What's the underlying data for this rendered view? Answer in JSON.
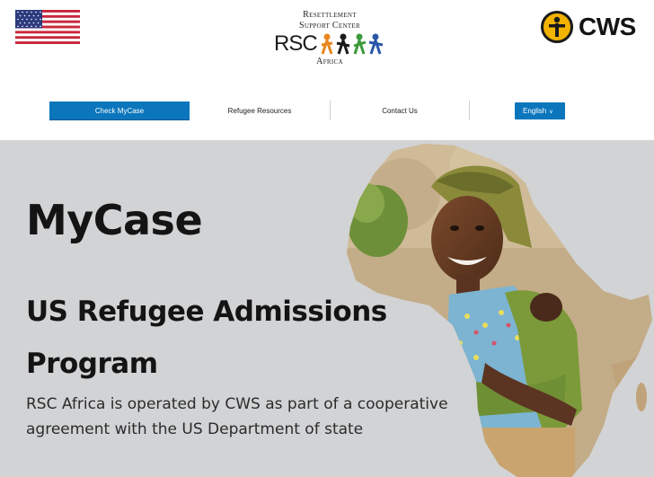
{
  "header": {
    "rsc_logo": {
      "line1": "Resettlement",
      "line2": "Support Center",
      "mark": "RSC",
      "line3": "Africa"
    },
    "cws_logo": {
      "text": "CWS"
    },
    "flag_icon": "us-flag-icon"
  },
  "nav": {
    "items": [
      {
        "label": "Check MyCase",
        "active": true
      },
      {
        "label": "Refugee Resources",
        "active": false
      },
      {
        "label": "Contact Us",
        "active": false
      }
    ],
    "language": {
      "label": "English",
      "icon": "chevron-down-icon"
    }
  },
  "hero": {
    "title": "MyCase",
    "subtitle": "US Refugee Admissions Program",
    "description": "RSC Africa is operated by CWS as part of a cooperative agreement with the US Department of state"
  },
  "colors": {
    "accent": "#0b76bc",
    "hero_bg": "#d2d3d5",
    "cws_yellow": "#f2b300"
  }
}
